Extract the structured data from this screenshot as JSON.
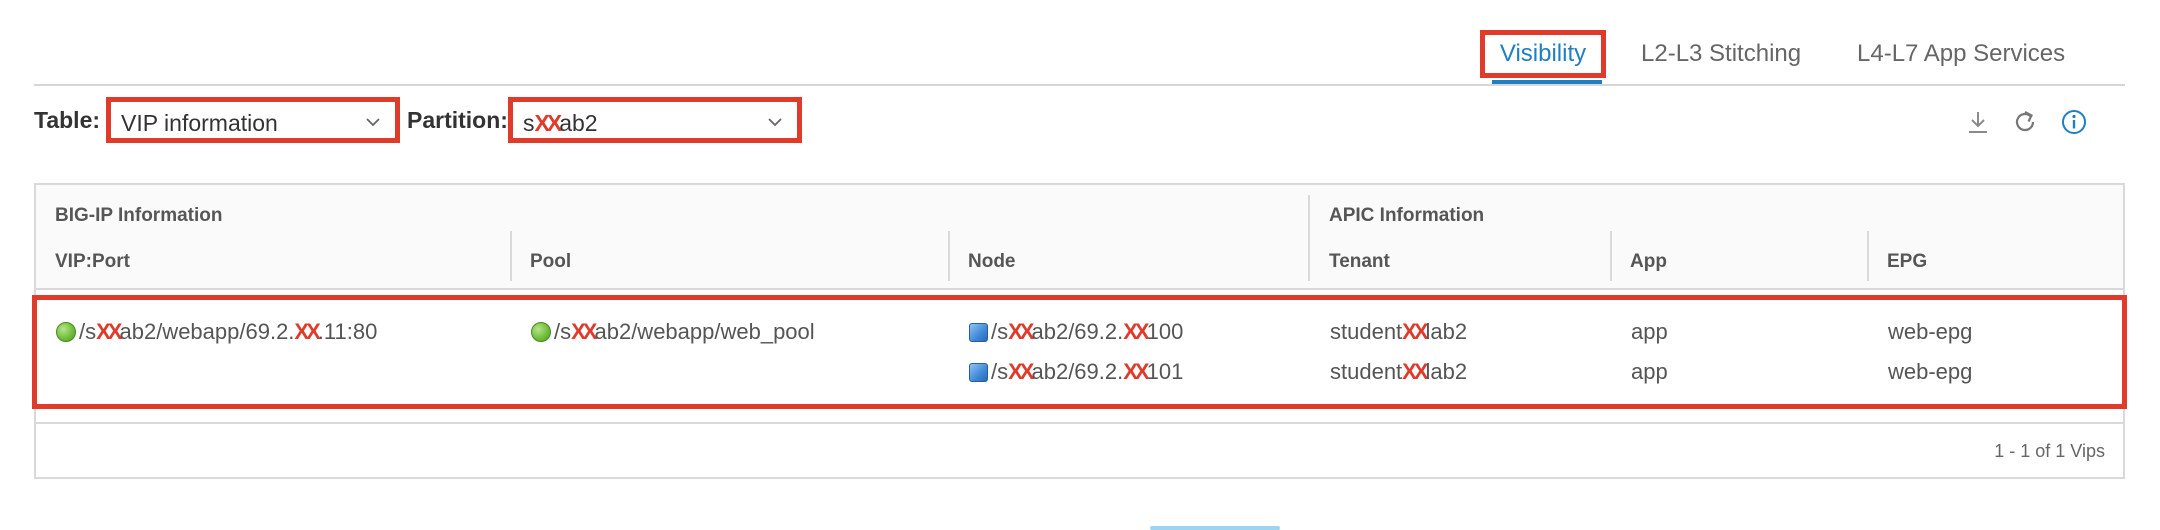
{
  "tabs": {
    "visibility": "Visibility",
    "stitching": "L2-L3 Stitching",
    "l4l7": "L4-L7 App Services",
    "active": "Visibility"
  },
  "toolbar": {
    "table_label": "Table:",
    "table_value": "VIP information",
    "partition_label": "Partition:",
    "partition_prefix": "s",
    "partition_mask": "XX",
    "partition_suffix": "ab2",
    "icons": [
      "download-icon",
      "refresh-icon",
      "info-icon"
    ]
  },
  "grid": {
    "groups": {
      "bigip": "BIG-IP Information",
      "apic": "APIC Information"
    },
    "columns": {
      "vip": "VIP:Port",
      "pool": "Pool",
      "node": "Node",
      "tenant": "Tenant",
      "app": "App",
      "epg": "EPG"
    },
    "row": {
      "vip": {
        "p1": "/s",
        "m1": "XX",
        "p2": "ab2/webapp/69.2.",
        "m2": "XX",
        "p3": ".11:80"
      },
      "pool": {
        "p1": "/s",
        "m1": "XX",
        "p2": "ab2/webapp/web_pool"
      },
      "nodes": [
        {
          "node": {
            "p1": "/s",
            "m1": "XX",
            "p2": "ab2/69.2.",
            "m2": "XX",
            "p3": "100"
          },
          "tenant": {
            "p1": "student",
            "m1": "XX",
            "p2": "lab2"
          },
          "app": "app",
          "epg": "web-epg"
        },
        {
          "node": {
            "p1": "/s",
            "m1": "XX",
            "p2": "ab2/69.2.",
            "m2": "XX",
            "p3": "101"
          },
          "tenant": {
            "p1": "student",
            "m1": "XX",
            "p2": "lab2"
          },
          "app": "app",
          "epg": "web-epg"
        }
      ]
    },
    "footer": "1 - 1 of 1 Vips"
  },
  "colors": {
    "accent": "#1f7fc2",
    "highlight_border": "#e03a2a",
    "status_up": "#72bf3c",
    "node_icon": "#3d89d8"
  }
}
